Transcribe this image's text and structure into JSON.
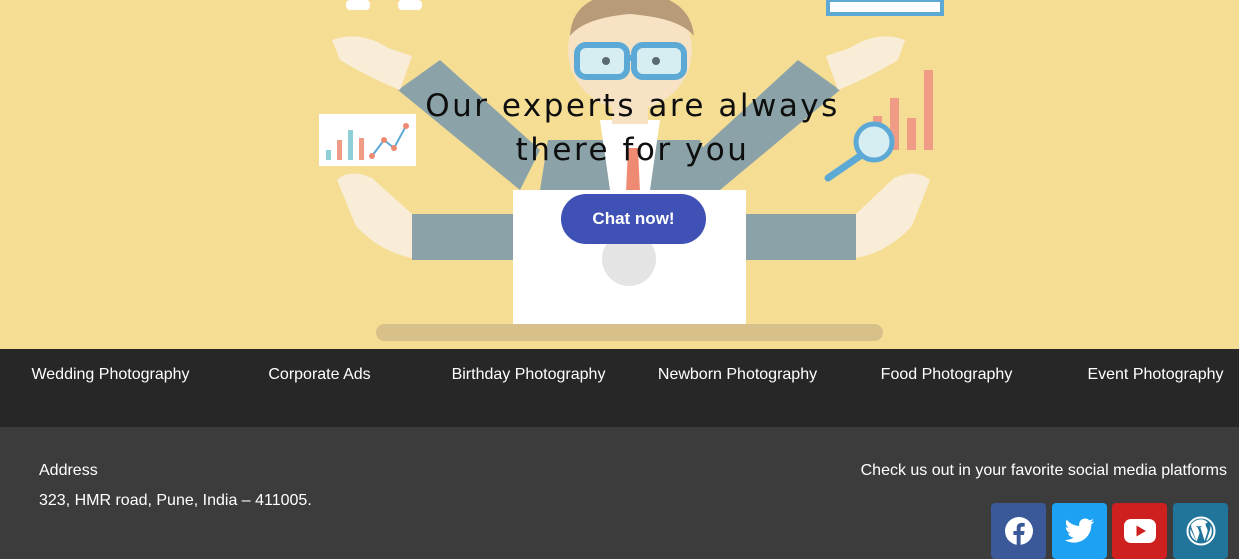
{
  "hero": {
    "title_line1": "Our experts are always",
    "title_line2": "there for you",
    "cta_label": "Chat now!"
  },
  "services": [
    {
      "label": "Wedding Photography"
    },
    {
      "label": "Corporate Ads"
    },
    {
      "label": "Birthday Photography"
    },
    {
      "label": "Newborn Photography"
    },
    {
      "label": "Food Photography"
    },
    {
      "label": "Event Photography"
    }
  ],
  "footer": {
    "address_title": "Address",
    "address_line": "323, HMR road, Pune, India – 411005.",
    "social_title": "Check us out in your favorite social media platforms",
    "social_links": [
      {
        "icon": "facebook-icon",
        "color": "#3b5998"
      },
      {
        "icon": "twitter-icon",
        "color": "#1da1f2"
      },
      {
        "icon": "youtube-icon",
        "color": "#cd201f"
      },
      {
        "icon": "wordpress-icon",
        "color": "#21759b"
      }
    ]
  },
  "colors": {
    "hero_bg": "#f5dd94",
    "cta_bg": "#3f51b5",
    "services_bg": "#272727",
    "footer_bg": "#3c3c3c"
  }
}
